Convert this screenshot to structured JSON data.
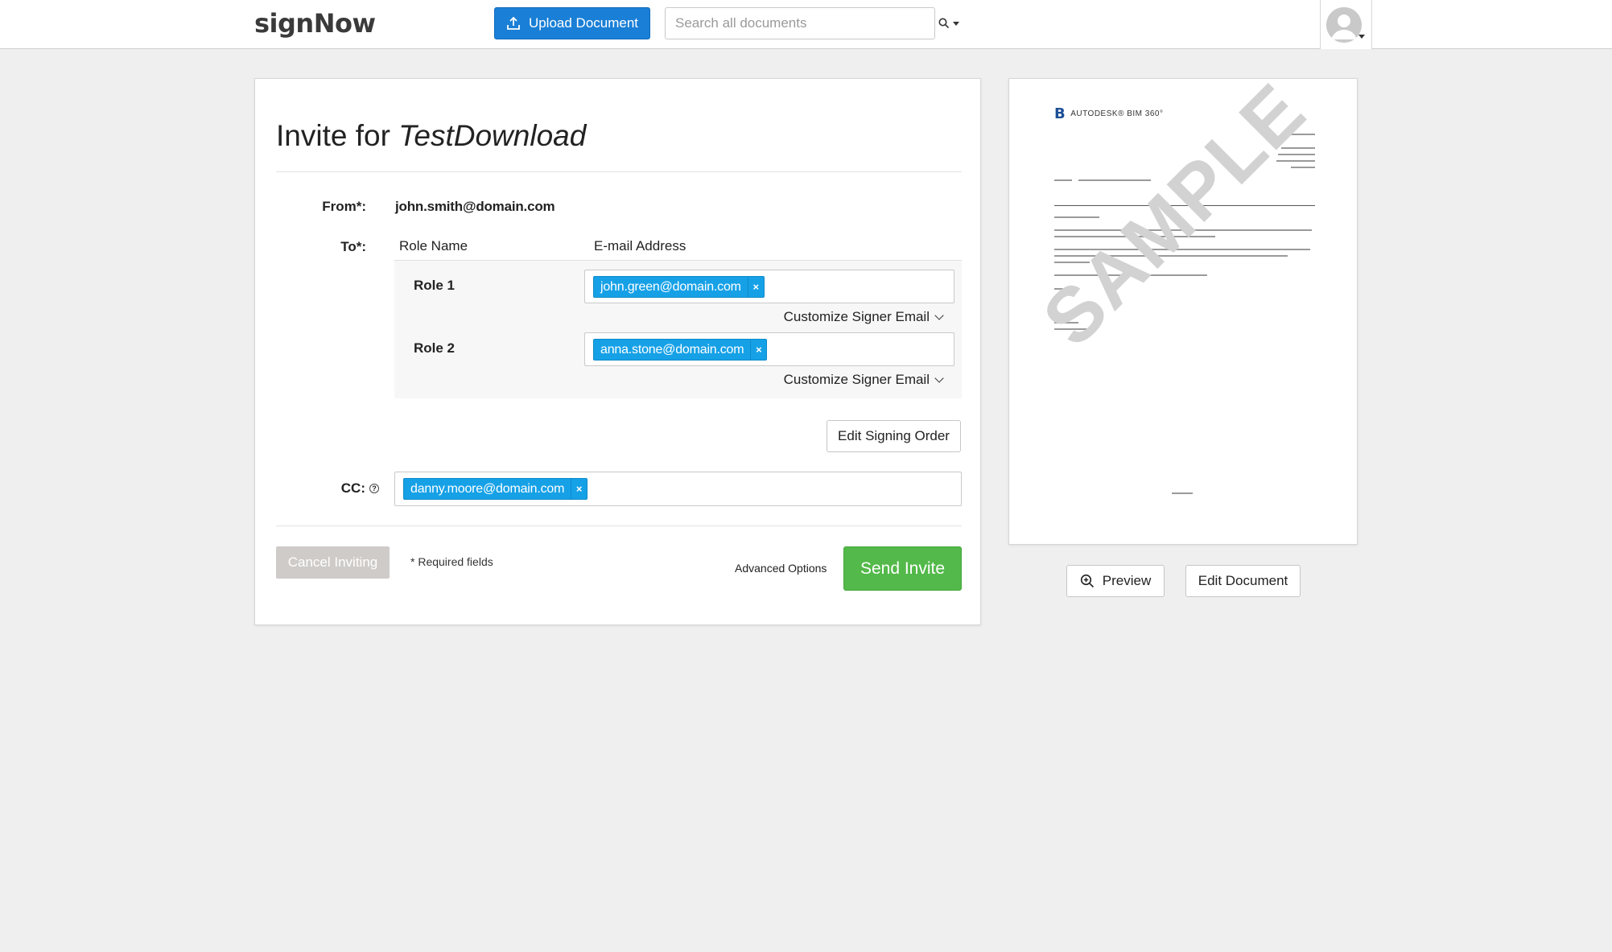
{
  "header": {
    "logo": "signNow",
    "upload_label": "Upload Document",
    "search_placeholder": "Search all documents",
    "search_icon": "search-icon",
    "avatar_icon": "user-avatar-icon"
  },
  "invite": {
    "title_prefix": "Invite for ",
    "document_name": "TestDownload",
    "from_label": "From*:",
    "from_value": "john.smith@domain.com",
    "to_label": "To*:",
    "role_col_header": "Role Name",
    "email_col_header": "E-mail Address",
    "roles": [
      {
        "name": "Role 1",
        "email": "john.green@domain.com",
        "customize_label": "Customize Signer Email"
      },
      {
        "name": "Role 2",
        "email": "anna.stone@domain.com",
        "customize_label": "Customize Signer Email"
      }
    ],
    "remove_tag_glyph": "×",
    "edit_signing_order_label": "Edit Signing Order",
    "cc_label": "CC:",
    "cc_help_glyph": "?",
    "cc_emails": [
      "danny.moore@domain.com"
    ],
    "cancel_label": "Cancel Inviting",
    "required_note": "* Required fields",
    "advanced_options_label": "Advanced Options",
    "send_label": "Send Invite"
  },
  "preview": {
    "brand_name": "AUTODESK® BIM 360°",
    "watermark": "SAMPLE",
    "preview_label": "Preview",
    "edit_document_label": "Edit Document"
  },
  "colors": {
    "primary_blue": "#1a7fd6",
    "tag_blue": "#16a1e7",
    "send_green": "#53b94a",
    "cancel_gray": "#cfcbc8",
    "page_background": "#efefef"
  }
}
